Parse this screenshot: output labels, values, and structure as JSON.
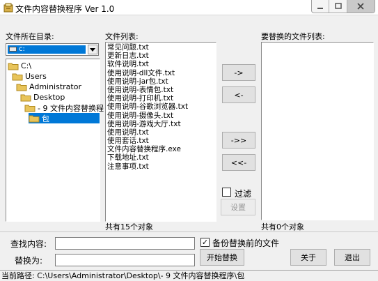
{
  "window": {
    "title": "文件内容替换程序 Ver 1.0",
    "title_color": "#000000"
  },
  "left": {
    "dir_label": "文件所在目录:",
    "drive_value": "c:",
    "tree": [
      {
        "label": "C:\\",
        "depth": 0,
        "selected": false
      },
      {
        "label": "Users",
        "depth": 1,
        "selected": false
      },
      {
        "label": "Administrator",
        "depth": 2,
        "selected": false
      },
      {
        "label": "Desktop",
        "depth": 3,
        "selected": false
      },
      {
        "label": "- 9 文件内容替换程",
        "depth": 4,
        "selected": false
      },
      {
        "label": "包",
        "depth": 5,
        "selected": true
      }
    ]
  },
  "file_list": {
    "label": "文件列表:",
    "items": [
      "常见问题.txt",
      "更新日志.txt",
      "软件说明.txt",
      "使用说明-dll文件.txt",
      "使用说明-jar包.txt",
      "使用说明-表情包.txt",
      "使用说明-打印机.txt",
      "使用说明-谷歌浏览器.txt",
      "使用说明-摄像头.txt",
      "使用说明-游戏大厅.txt",
      "使用说明.txt",
      "使用套话.txt",
      "文件内容替换程序.exe",
      "下载地址.txt",
      "注意事项.txt"
    ],
    "count_text": "共有15个对象"
  },
  "move_buttons": {
    "add": "->",
    "remove": "<-",
    "add_all": "->>",
    "remove_all": "<<-"
  },
  "target": {
    "label": "要替换的文件列表:",
    "count_text": "共有0个对象",
    "filter_label": "过滤",
    "settings_label": "设置"
  },
  "form": {
    "find_label": "查找内容:",
    "find_value": "",
    "replace_label": "替换为:",
    "replace_value": "",
    "backup_label": "备份替换前的文件",
    "backup_checked": true,
    "check_mark": "✓",
    "start_label": "开始替换",
    "about_label": "关于",
    "exit_label": "退出"
  },
  "status": {
    "path": "当前路径: C:\\Users\\Administrator\\Desktop\\- 9 文件内容替换程序\\包"
  },
  "colors": {
    "selection": "#0078d7",
    "folder": "#e8c45a",
    "folder_edge": "#b08a20"
  }
}
